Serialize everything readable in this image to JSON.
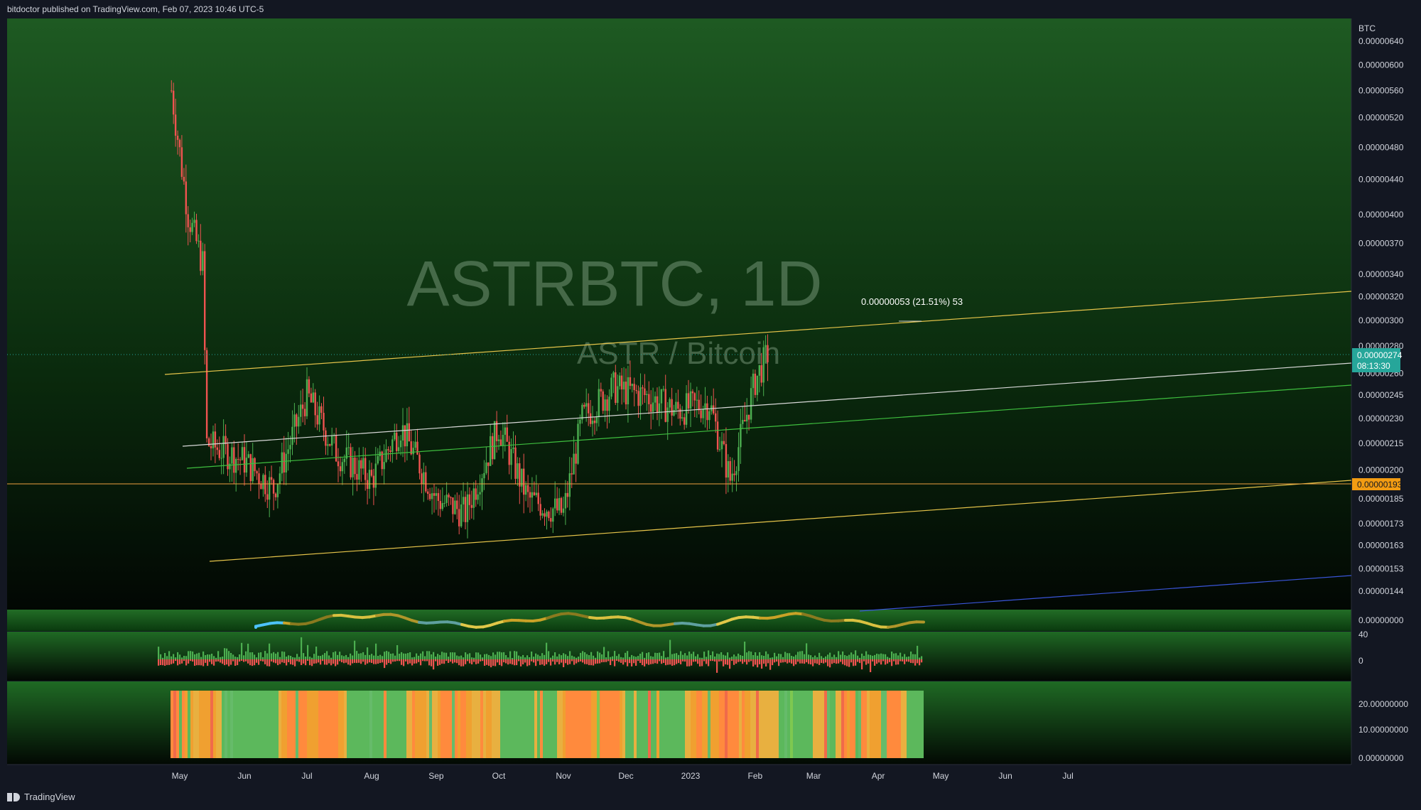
{
  "header": {
    "published": "bitdoctor published on TradingView.com, Feb 07, 2023 10:46 UTC-5"
  },
  "footer": {
    "brand": "TradingView"
  },
  "watermark": {
    "symbol": "ASTRBTC, 1D",
    "name": "ASTR / Bitcoin"
  },
  "colors": {
    "up": "#4caf50",
    "down": "#ef5350",
    "channel_outer": "#e6c44a",
    "channel_mid": "#d8d8d8",
    "channel_green": "#3fbf3f",
    "support_line": "#f0a040",
    "blue_line": "#3a55d8",
    "last_price_bg": "#26a69a",
    "support_label_bg": "#f39c12"
  },
  "chart_data": {
    "type": "candlestick",
    "symbol": "ASTRBTC",
    "interval": "1D",
    "price_scale_unit": "BTC",
    "y_ticks": [
      "0.00000640",
      "0.00000600",
      "0.00000560",
      "0.00000520",
      "0.00000480",
      "0.00000440",
      "0.00000400",
      "0.00000370",
      "0.00000340",
      "0.00000320",
      "0.00000300",
      "0.00000280",
      "0.00000260",
      "0.00000245",
      "0.00000230",
      "0.00000215",
      "0.00000200",
      "0.00000185",
      "0.00000173",
      "0.00000163",
      "0.00000153",
      "0.00000144"
    ],
    "x_ticks": [
      "May",
      "Jun",
      "Jul",
      "Aug",
      "Sep",
      "Oct",
      "Nov",
      "Dec",
      "2023",
      "Feb",
      "Mar",
      "Apr",
      "May",
      "Jun",
      "Jul"
    ],
    "last_price": {
      "value": "0.00000274",
      "countdown": "08:13:30"
    },
    "support_level": {
      "value": "0.00000193"
    },
    "measure_annotation": "0.00000053 (21.51%) 53",
    "monthly_closes": [
      {
        "date": "2022-04-27",
        "close": 5.6e-06
      },
      {
        "date": "2022-05-05",
        "close": 4e-06
      },
      {
        "date": "2022-05-12",
        "close": 3.5e-06
      },
      {
        "date": "2022-05-14",
        "close": 2.15e-06
      },
      {
        "date": "2022-06-01",
        "close": 2.05e-06
      },
      {
        "date": "2022-06-15",
        "close": 1.9e-06
      },
      {
        "date": "2022-07-01",
        "close": 2.45e-06
      },
      {
        "date": "2022-07-15",
        "close": 2.1e-06
      },
      {
        "date": "2022-08-01",
        "close": 1.95e-06
      },
      {
        "date": "2022-08-15",
        "close": 2.25e-06
      },
      {
        "date": "2022-09-01",
        "close": 1.85e-06
      },
      {
        "date": "2022-09-15",
        "close": 1.78e-06
      },
      {
        "date": "2022-10-01",
        "close": 2.25e-06
      },
      {
        "date": "2022-10-15",
        "close": 1.85e-06
      },
      {
        "date": "2022-11-01",
        "close": 1.78e-06
      },
      {
        "date": "2022-11-10",
        "close": 2.3e-06
      },
      {
        "date": "2022-11-25",
        "close": 2.5e-06
      },
      {
        "date": "2022-12-10",
        "close": 2.45e-06
      },
      {
        "date": "2022-12-25",
        "close": 2.35e-06
      },
      {
        "date": "2023-01-10",
        "close": 2.4e-06
      },
      {
        "date": "2023-01-20",
        "close": 1.95e-06
      },
      {
        "date": "2023-02-01",
        "close": 2.55e-06
      },
      {
        "date": "2023-02-07",
        "close": 2.74e-06
      }
    ],
    "indicator_1": {
      "y_ticks": [
        "0.00000000"
      ]
    },
    "indicator_2": {
      "y_ticks": [
        "40",
        "0"
      ]
    },
    "indicator_3": {
      "y_ticks": [
        "20.00000000",
        "10.00000000",
        "0.00000000"
      ]
    }
  }
}
